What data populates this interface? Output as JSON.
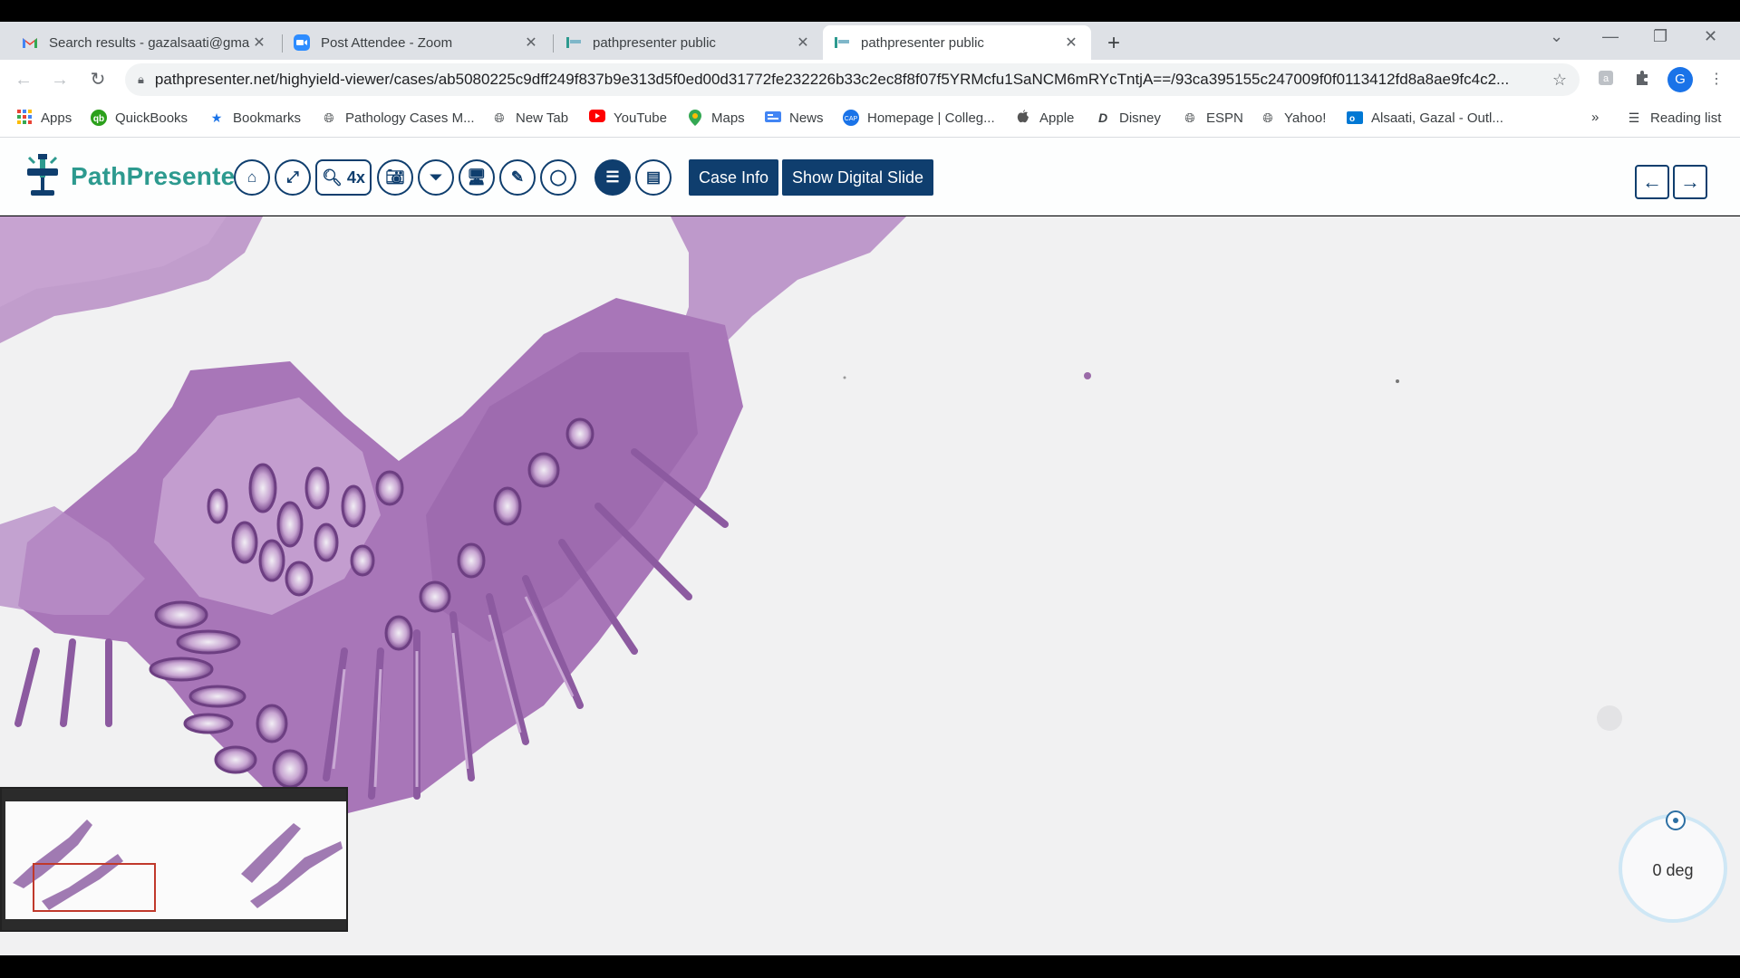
{
  "tabs": [
    {
      "title": "Search results - gazalsaati@gmai",
      "icon": "gmail-icon"
    },
    {
      "title": "Post Attendee - Zoom",
      "icon": "zoom-icon"
    },
    {
      "title": "pathpresenter public",
      "icon": "pathpresenter-icon"
    },
    {
      "title": "pathpresenter public",
      "icon": "pathpresenter-icon"
    }
  ],
  "address": {
    "url": "pathpresenter.net/highyield-viewer/cases/ab5080225c9dff249f837b9e313d5f0ed00d31772fe232226b33c2ec8f8f07f5YRMcfu1SaNCM6mRYcTntjA==/93ca395155c247009f0f0113412fd8a8ae9fc4c2..."
  },
  "profile_initial": "G",
  "bookmarks": [
    {
      "label": "Apps",
      "icon": "apps-grid-icon"
    },
    {
      "label": "QuickBooks",
      "icon": "quickbooks-icon"
    },
    {
      "label": "Bookmarks",
      "icon": "star-icon"
    },
    {
      "label": "Pathology Cases M...",
      "icon": "globe-icon"
    },
    {
      "label": "New Tab",
      "icon": "globe-icon"
    },
    {
      "label": "YouTube",
      "icon": "youtube-icon"
    },
    {
      "label": "Maps",
      "icon": "maps-icon"
    },
    {
      "label": "News",
      "icon": "news-icon"
    },
    {
      "label": "Homepage | Colleg...",
      "icon": "cap-icon"
    },
    {
      "label": "Apple",
      "icon": "apple-icon"
    },
    {
      "label": "Disney",
      "icon": "disney-icon"
    },
    {
      "label": "ESPN",
      "icon": "globe-icon"
    },
    {
      "label": "Yahoo!",
      "icon": "globe-icon"
    },
    {
      "label": "Alsaati, Gazal - Outl...",
      "icon": "outlook-icon"
    }
  ],
  "reading_list": "Reading list",
  "app": {
    "brand": "PathPresenter",
    "zoom_label": "4x",
    "case_info": "Case Info",
    "show_digital_slide": "Show Digital Slide"
  },
  "rotation": {
    "label": "0 deg"
  },
  "colors": {
    "brand_navy": "#0f3e6e",
    "brand_teal": "#2d9a8f",
    "tissue": "#9a6aa8",
    "viewport_box": "#c0392b"
  }
}
